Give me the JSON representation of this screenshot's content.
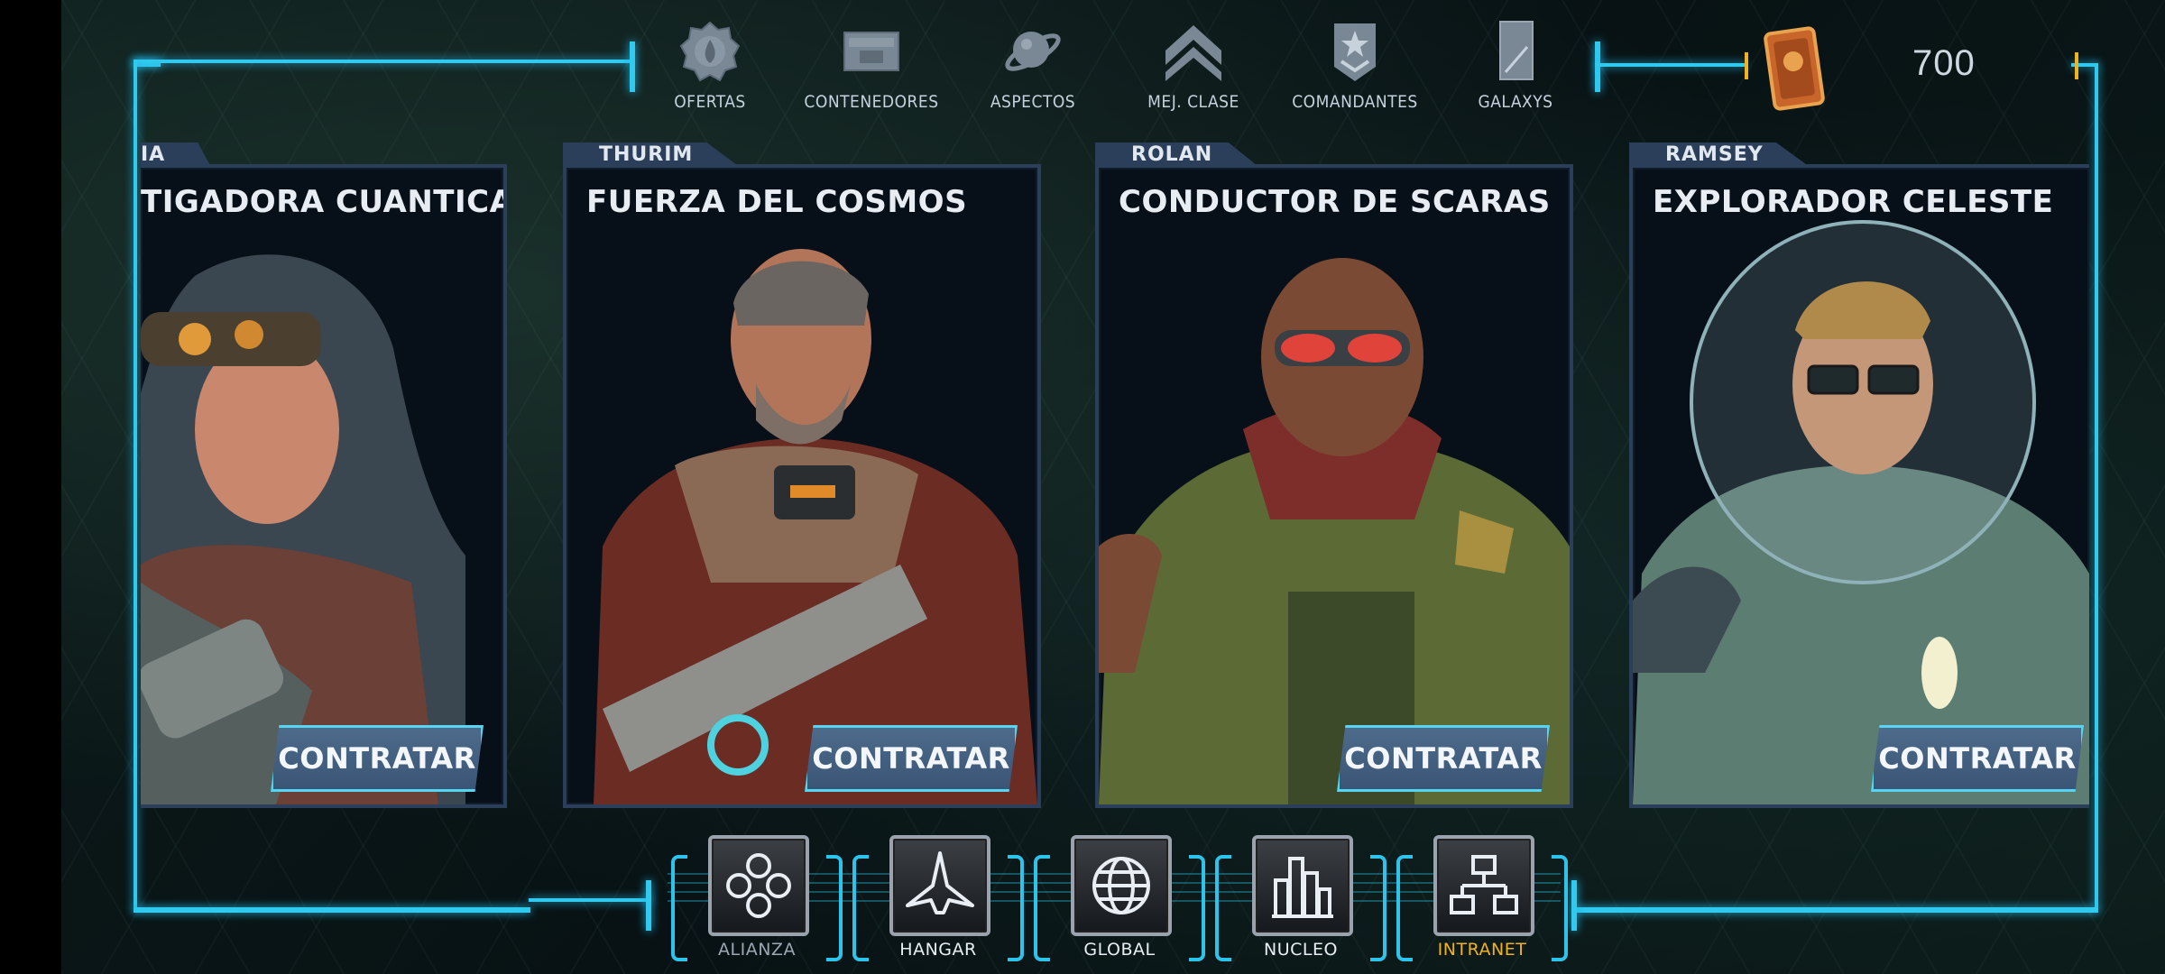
{
  "top_nav": [
    {
      "label": "OFERTAS",
      "icon": "offers-gear-icon"
    },
    {
      "label": "CONTENEDORES",
      "icon": "container-icon"
    },
    {
      "label": "ASPECTOS",
      "icon": "planet-icon"
    },
    {
      "label": "MEJ. CLASE",
      "icon": "rank-chevron-icon"
    },
    {
      "label": "COMANDANTES",
      "icon": "commander-badge-icon"
    },
    {
      "label": "GALAXYS",
      "icon": "galaxys-card-icon"
    }
  ],
  "currency": {
    "amount": "700",
    "icon": "card-currency-icon"
  },
  "cards": [
    {
      "name": "IA",
      "title": "TIGADORA CUANTICA",
      "button": "CONTRATAR"
    },
    {
      "name": "THURIM",
      "title": "FUERZA DEL COSMOS",
      "button": "CONTRATAR"
    },
    {
      "name": "ROLAN",
      "title": "CONDUCTOR DE SCARAS",
      "button": "CONTRATAR"
    },
    {
      "name": "RAMSEY",
      "title": "EXPLORADOR CELESTE",
      "button": "CONTRATAR"
    }
  ],
  "bottom_nav": [
    {
      "label": "ALIANZA",
      "icon": "alliance-icon"
    },
    {
      "label": "HANGAR",
      "icon": "ship-icon"
    },
    {
      "label": "GLOBAL",
      "icon": "globe-icon"
    },
    {
      "label": "NUCLEO",
      "icon": "city-icon"
    },
    {
      "label": "INTRANET",
      "icon": "network-icon",
      "active": true
    }
  ],
  "colors": {
    "frame": "#31c9ee",
    "accent": "#f2b120",
    "card_border": "#2c3f5a",
    "button": "#4e6b8c"
  }
}
